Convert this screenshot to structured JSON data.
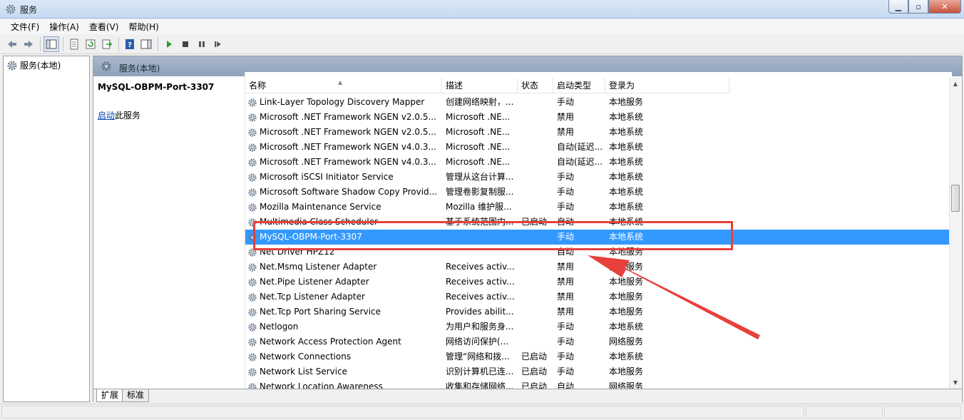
{
  "window": {
    "title": "服务"
  },
  "menu": [
    {
      "label": "文件(F)"
    },
    {
      "label": "操作(A)"
    },
    {
      "label": "查看(V)"
    },
    {
      "label": "帮助(H)"
    }
  ],
  "tree": {
    "root": "服务(本地)"
  },
  "panel": {
    "header": "服务(本地)"
  },
  "detail": {
    "service_name": "MySQL-OBPM-Port-3307",
    "start_link": "启动",
    "start_suffix": "此服务"
  },
  "table": {
    "columns": [
      "名称",
      "描述",
      "状态",
      "启动类型",
      "登录为"
    ],
    "rows": [
      {
        "name": "Link-Layer Topology Discovery Mapper",
        "desc": "创建网络映射，...",
        "status": "",
        "startup": "手动",
        "logon": "本地服务"
      },
      {
        "name": "Microsoft .NET Framework NGEN v2.0.5...",
        "desc": "Microsoft .NE...",
        "status": "",
        "startup": "禁用",
        "logon": "本地系统"
      },
      {
        "name": "Microsoft .NET Framework NGEN v2.0.5...",
        "desc": "Microsoft .NE...",
        "status": "",
        "startup": "禁用",
        "logon": "本地系统"
      },
      {
        "name": "Microsoft .NET Framework NGEN v4.0.3...",
        "desc": "Microsoft .NE...",
        "status": "",
        "startup": "自动(延迟...",
        "logon": "本地系统"
      },
      {
        "name": "Microsoft .NET Framework NGEN v4.0.3...",
        "desc": "Microsoft .NE...",
        "status": "",
        "startup": "自动(延迟...",
        "logon": "本地系统"
      },
      {
        "name": "Microsoft iSCSI Initiator Service",
        "desc": "管理从这台计算...",
        "status": "",
        "startup": "手动",
        "logon": "本地系统"
      },
      {
        "name": "Microsoft Software Shadow Copy Provid...",
        "desc": "管理卷影复制服...",
        "status": "",
        "startup": "手动",
        "logon": "本地系统"
      },
      {
        "name": "Mozilla Maintenance Service",
        "desc": "Mozilla 维护服...",
        "status": "",
        "startup": "手动",
        "logon": "本地系统"
      },
      {
        "name": "Multimedia Class Scheduler",
        "desc": "基于系统范围内...",
        "status": "已启动",
        "startup": "自动",
        "logon": "本地系统"
      },
      {
        "name": "MySQL-OBPM-Port-3307",
        "desc": "",
        "status": "",
        "startup": "手动",
        "logon": "本地系统",
        "selected": true
      },
      {
        "name": "Net Driver HPZ12",
        "desc": "",
        "status": "",
        "startup": "自动",
        "logon": "本地服务"
      },
      {
        "name": "Net.Msmq Listener Adapter",
        "desc": "Receives activ...",
        "status": "",
        "startup": "禁用",
        "logon": "网络服务"
      },
      {
        "name": "Net.Pipe Listener Adapter",
        "desc": "Receives activ...",
        "status": "",
        "startup": "禁用",
        "logon": "本地服务"
      },
      {
        "name": "Net.Tcp Listener Adapter",
        "desc": "Receives activ...",
        "status": "",
        "startup": "禁用",
        "logon": "本地服务"
      },
      {
        "name": "Net.Tcp Port Sharing Service",
        "desc": "Provides abilit...",
        "status": "",
        "startup": "禁用",
        "logon": "本地服务"
      },
      {
        "name": "Netlogon",
        "desc": "为用户和服务身...",
        "status": "",
        "startup": "手动",
        "logon": "本地系统"
      },
      {
        "name": "Network Access Protection Agent",
        "desc": "网络访问保护(...",
        "status": "",
        "startup": "手动",
        "logon": "网络服务"
      },
      {
        "name": "Network Connections",
        "desc": "管理“网络和拨...",
        "status": "已启动",
        "startup": "手动",
        "logon": "本地系统"
      },
      {
        "name": "Network List Service",
        "desc": "识别计算机已连...",
        "status": "已启动",
        "startup": "手动",
        "logon": "本地服务"
      },
      {
        "name": "Network Location Awareness",
        "desc": "收集和存储网络...",
        "status": "已启动",
        "startup": "自动",
        "logon": "网络服务"
      }
    ]
  },
  "tabs": [
    {
      "label": "扩展"
    },
    {
      "label": "标准"
    }
  ],
  "colors": {
    "selection": "#3399ff",
    "annotation": "#e8403c"
  }
}
